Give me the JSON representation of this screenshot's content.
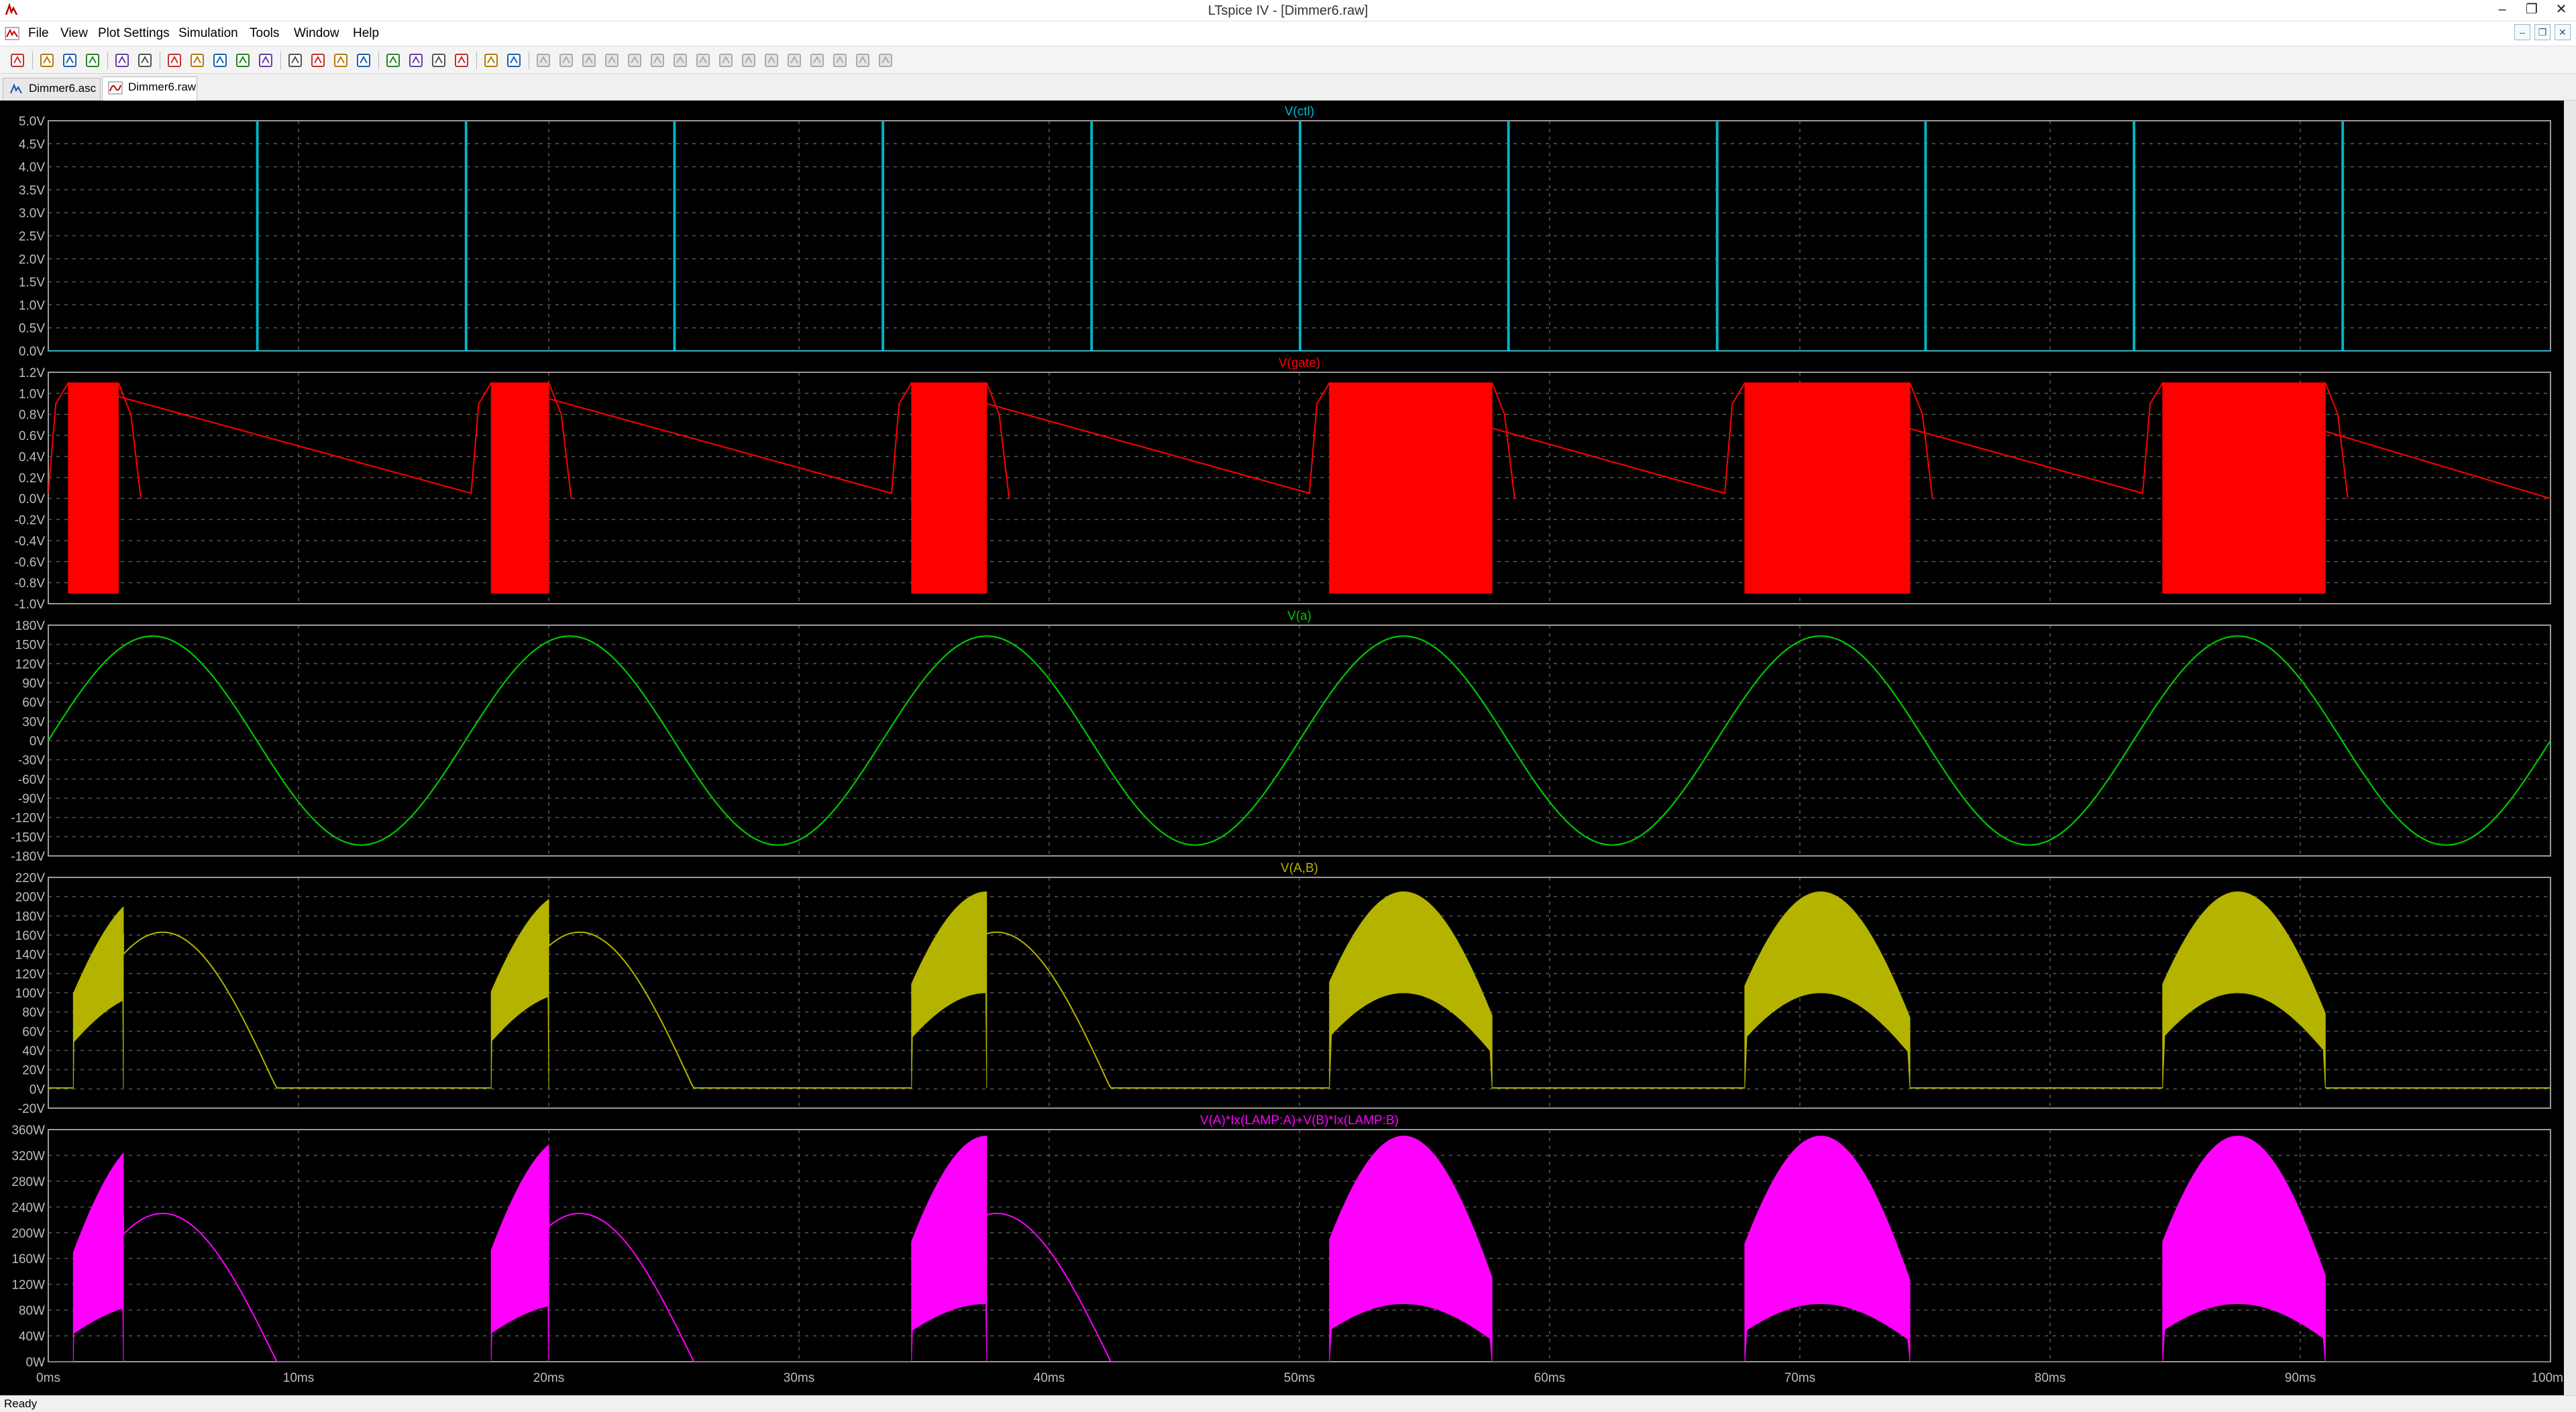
{
  "window": {
    "title": "LTspice IV - [Dimmer6.raw]",
    "minimize": "–",
    "restore": "❐",
    "close": "✕"
  },
  "menu": [
    "File",
    "View",
    "Plot Settings",
    "Simulation",
    "Tools",
    "Window",
    "Help"
  ],
  "mdi_controls": [
    "–",
    "❐",
    "✕"
  ],
  "toolbar_icons": [
    "new-schematic-icon",
    "open-icon",
    "save-icon",
    "control-panel-icon",
    "run-icon",
    "halt-icon",
    "zoom-in-icon",
    "zoom-out-icon",
    "zoom-fit-icon",
    "zoom-cancel-icon",
    "autorange-icon",
    "waveform-icon",
    "tile-horizontal-icon",
    "cascade-icon",
    "tile-vertical-icon",
    "cut-icon",
    "copy-icon",
    "paste-icon",
    "find-icon",
    "print-preview-icon",
    "print-icon",
    "wire-icon",
    "ground-icon",
    "label-icon",
    "resistor-icon",
    "capacitor-icon",
    "inductor-icon",
    "diode-icon",
    "component-icon",
    "move-icon",
    "drag-icon",
    "undo-icon",
    "redo-icon",
    "rotate-icon",
    "mirror-icon",
    "text-icon",
    "spice-directive-icon"
  ],
  "tabs": [
    {
      "label": "Dimmer6.asc",
      "icon": "schematic-icon",
      "active": false
    },
    {
      "label": "Dimmer6.raw",
      "icon": "waveform-icon",
      "active": true
    }
  ],
  "status": "Ready",
  "colors": {
    "background": "#000000",
    "grid": "#5a5a5a",
    "axis": "#9a9a9a",
    "tick_text": "#bdbdbd",
    "ctl": "#00b7c8",
    "gate": "#ff0000",
    "a": "#00c800",
    "ab": "#b4b400",
    "power": "#ff00ff"
  },
  "x_axis": {
    "ticks": [
      "0ms",
      "10ms",
      "20ms",
      "30ms",
      "40ms",
      "50ms",
      "60ms",
      "70ms",
      "80ms",
      "90ms",
      "100ms"
    ],
    "range": [
      0,
      100
    ]
  },
  "chart_data": [
    {
      "type": "line",
      "title": "V(ctl)",
      "color": "#00b7c8",
      "xlim": [
        0,
        100
      ],
      "ylim": [
        0,
        5
      ],
      "yticks": [
        "5.0V",
        "4.5V",
        "4.0V",
        "3.5V",
        "3.0V",
        "2.5V",
        "2.0V",
        "1.5V",
        "1.0V",
        "0.5V",
        "0.0V"
      ],
      "description_values": {
        "pulse_times_ms": [
          8.33,
          16.67,
          25,
          33.33,
          41.67,
          50,
          58.33,
          66.67,
          75,
          83.33,
          91.67
        ],
        "low_level": 0,
        "high_level": 5
      }
    },
    {
      "type": "line",
      "title": "V(gate)",
      "color": "#ff0000",
      "xlim": [
        0,
        100
      ],
      "ylim": [
        -1.0,
        1.2
      ],
      "yticks": [
        "1.2V",
        "1.0V",
        "0.8V",
        "0.6V",
        "0.4V",
        "0.2V",
        "0.0V",
        "-0.2V",
        "-0.4V",
        "-0.6V",
        "-0.8V",
        "-1.0V"
      ],
      "description_values": {
        "bursts_ms": [
          [
            0.8,
            2.8
          ],
          [
            17.7,
            20.0
          ],
          [
            34.5,
            37.5
          ],
          [
            51.2,
            57.7
          ],
          [
            67.8,
            74.4
          ],
          [
            84.5,
            91.0
          ]
        ],
        "amplitude": 1.1
      }
    },
    {
      "type": "line",
      "title": "V(a)",
      "color": "#00c800",
      "xlim": [
        0,
        100
      ],
      "ylim": [
        -180,
        180
      ],
      "yticks": [
        "180V",
        "150V",
        "120V",
        "90V",
        "60V",
        "30V",
        "0V",
        "-30V",
        "-60V",
        "-90V",
        "-120V",
        "-150V",
        "-180V"
      ],
      "description_values": {
        "amplitude": 163,
        "frequency_hz": 60
      }
    },
    {
      "type": "line",
      "title": "V(A,B)",
      "color": "#b4b400",
      "xlim": [
        0,
        100
      ],
      "ylim": [
        -20,
        220
      ],
      "yticks": [
        "220V",
        "200V",
        "180V",
        "160V",
        "140V",
        "120V",
        "100V",
        "80V",
        "60V",
        "40V",
        "20V",
        "0V",
        "-20V"
      ],
      "description_values": {
        "peak": 205,
        "inner_envelope_peak": 100,
        "smooth_peak": 163
      }
    },
    {
      "type": "line",
      "title": "V(A)*Ix(LAMP:A)+V(B)*Ix(LAMP:B)",
      "color": "#ff00ff",
      "xlim": [
        0,
        100
      ],
      "ylim": [
        0,
        360
      ],
      "yticks": [
        "360W",
        "320W",
        "280W",
        "240W",
        "200W",
        "160W",
        "120W",
        "80W",
        "40W",
        "0W"
      ],
      "description_values": {
        "peak": 350,
        "inner_envelope_peak": 90,
        "smooth_peak": 230
      }
    }
  ]
}
